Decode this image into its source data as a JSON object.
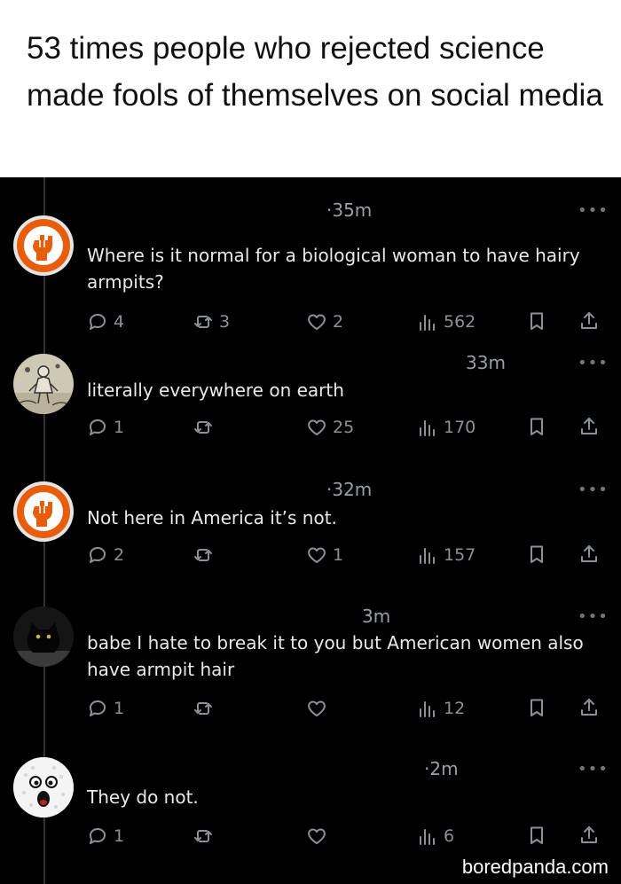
{
  "header": {
    "title": "53 times people who rejected science made fools of themselves on social media"
  },
  "more_label": "•••",
  "tweets": [
    {
      "avatar": "fist-logo",
      "time": "·35m",
      "text": "Where is it normal for a biological woman to have hairy armpits?",
      "replies": "4",
      "reposts": "3",
      "likes": "2",
      "views": "562"
    },
    {
      "avatar": "sketch-figure",
      "time": "33m",
      "text": "literally everywhere on earth",
      "replies": "1",
      "reposts": "",
      "likes": "25",
      "views": "170"
    },
    {
      "avatar": "fist-logo",
      "time": "·32m",
      "text": "Not here in America it’s not.",
      "replies": "2",
      "reposts": "",
      "likes": "1",
      "views": "157"
    },
    {
      "avatar": "black-cat",
      "time": "3m",
      "text": "babe I hate to break it to you but American women also have armpit hair",
      "replies": "1",
      "reposts": "",
      "likes": "",
      "views": "12"
    },
    {
      "avatar": "golf-ball-face",
      "time": "·2m",
      "text": "They do not.",
      "replies": "1",
      "reposts": "",
      "likes": "",
      "views": "6"
    }
  ],
  "watermark": "boredpanda.com"
}
